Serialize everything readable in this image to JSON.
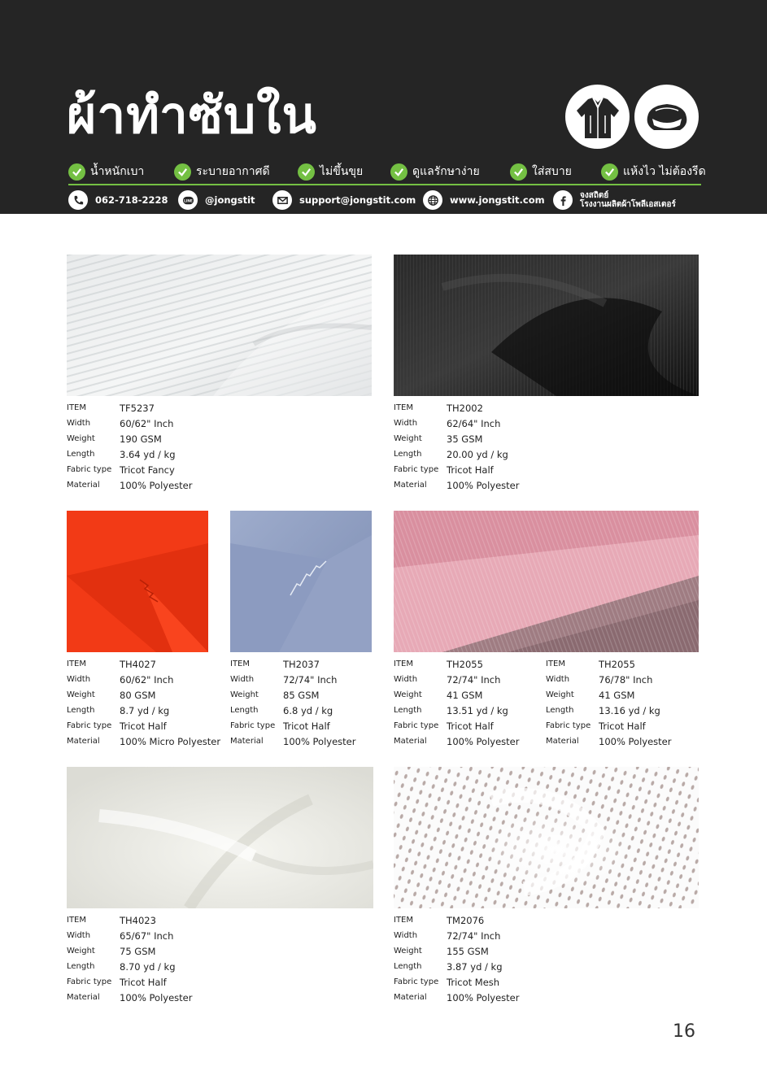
{
  "header": {
    "title": "ผ้าทำซับใน",
    "icons": [
      "shirt-icon",
      "cap-icon"
    ],
    "features": [
      {
        "label": "น้ำหนักเบา"
      },
      {
        "label": "ระบายอากาศดี"
      },
      {
        "label": "ไม่ขึ้นขุย"
      },
      {
        "label": "ดูแลรักษาง่าย"
      },
      {
        "label": "ใส่สบาย"
      },
      {
        "label": "แห้งไว ไม่ต้องรีด"
      }
    ],
    "contacts": {
      "phone": "062-718-2228",
      "line": "@jongstit",
      "line_badge": "LINE",
      "email": "support@jongstit.com",
      "web": "www.jongstit.com",
      "facebook_line1": "จงสถิตย์",
      "facebook_line2": "โรงงานผลิตผ้าโพลีเอสเตอร์"
    },
    "colors": {
      "background": "#252525",
      "accent": "#74c043"
    }
  },
  "products": [
    {
      "image": "white-striped-tricot-fabric",
      "specs": [
        {
          "key": "ITEM",
          "value": "TF5237"
        },
        {
          "key": "Width",
          "value": "60/62\" Inch"
        },
        {
          "key": "Weight",
          "value": "190 GSM"
        },
        {
          "key": "Length",
          "value": "3.64 yd / kg"
        },
        {
          "key": "Fabric type",
          "value": "Tricot Fancy"
        },
        {
          "key": "Material",
          "value": "100% Polyester"
        }
      ]
    },
    {
      "image": "black-tricot-fabric",
      "specs": [
        {
          "key": "ITEM",
          "value": "TH2002"
        },
        {
          "key": "Width",
          "value": "62/64\" Inch"
        },
        {
          "key": "Weight",
          "value": "35 GSM"
        },
        {
          "key": "Length",
          "value": "20.00 yd / kg"
        },
        {
          "key": "Fabric type",
          "value": "Tricot Half"
        },
        {
          "key": "Material",
          "value": "100% Polyester"
        }
      ]
    },
    {
      "image": "orange-red-tricot-fabric",
      "specs": [
        {
          "key": "ITEM",
          "value": "TH4027"
        },
        {
          "key": "Width",
          "value": "60/62\" Inch"
        },
        {
          "key": "Weight",
          "value": "80 GSM"
        },
        {
          "key": "Length",
          "value": "8.7 yd / kg"
        },
        {
          "key": "Fabric type",
          "value": "Tricot Half"
        },
        {
          "key": "Material",
          "value": "100% Micro Polyester"
        }
      ]
    },
    {
      "image": "blue-grey-tricot-fabric",
      "specs": [
        {
          "key": "ITEM",
          "value": "TH2037"
        },
        {
          "key": "Width",
          "value": "72/74\" Inch"
        },
        {
          "key": "Weight",
          "value": "85 GSM"
        },
        {
          "key": "Length",
          "value": "6.8 yd / kg"
        },
        {
          "key": "Fabric type",
          "value": "Tricot Half"
        },
        {
          "key": "Material",
          "value": "100% Polyester"
        }
      ]
    },
    {
      "image": "pink-and-mauve-tricot-fabric",
      "specs": [
        {
          "key": "ITEM",
          "value": "TH2055"
        },
        {
          "key": "Width",
          "value": "72/74\" Inch"
        },
        {
          "key": "Weight",
          "value": "41 GSM"
        },
        {
          "key": "Length",
          "value": "13.51 yd / kg"
        },
        {
          "key": "Fabric type",
          "value": "Tricot Half"
        },
        {
          "key": "Material",
          "value": "100% Polyester"
        }
      ]
    },
    {
      "specs": [
        {
          "key": "ITEM",
          "value": "TH2055"
        },
        {
          "key": "Width",
          "value": "76/78\" Inch"
        },
        {
          "key": "Weight",
          "value": "41 GSM"
        },
        {
          "key": "Length",
          "value": "13.16 yd / kg"
        },
        {
          "key": "Fabric type",
          "value": "Tricot Half"
        },
        {
          "key": "Material",
          "value": "100% Polyester"
        }
      ]
    },
    {
      "image": "off-white-tricot-fabric",
      "specs": [
        {
          "key": "ITEM",
          "value": "TH4023"
        },
        {
          "key": "Width",
          "value": "65/67\" Inch"
        },
        {
          "key": "Weight",
          "value": "75 GSM"
        },
        {
          "key": "Length",
          "value": "8.70 yd / kg"
        },
        {
          "key": "Fabric type",
          "value": "Tricot Half"
        },
        {
          "key": "Material",
          "value": "100% Polyester"
        }
      ]
    },
    {
      "image": "white-mesh-fabric",
      "specs": [
        {
          "key": "ITEM",
          "value": "TM2076"
        },
        {
          "key": "Width",
          "value": "72/74\" Inch"
        },
        {
          "key": "Weight",
          "value": "155 GSM"
        },
        {
          "key": "Length",
          "value": "3.87 yd / kg"
        },
        {
          "key": "Fabric type",
          "value": "Tricot Mesh"
        },
        {
          "key": "Material",
          "value": "100% Polyester"
        }
      ]
    }
  ],
  "page_number": "16"
}
